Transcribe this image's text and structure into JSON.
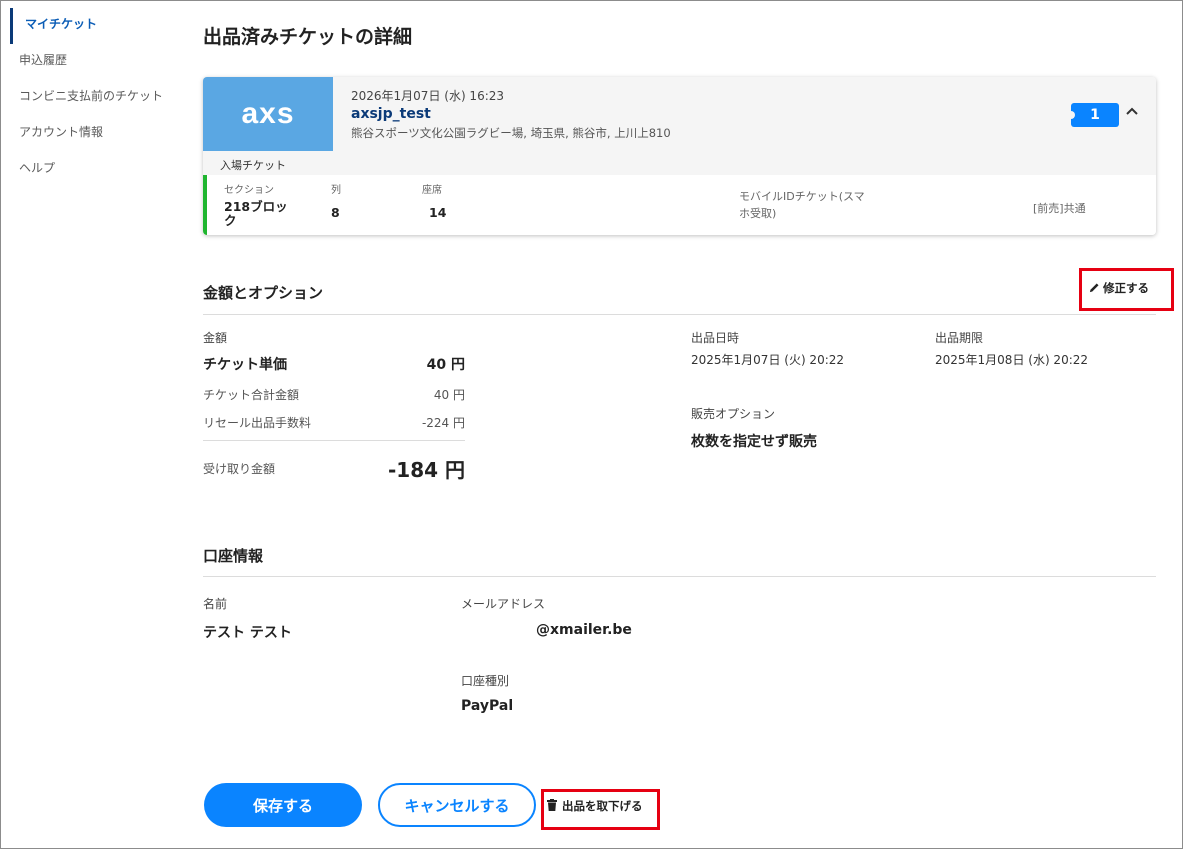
{
  "sidebar": {
    "items": [
      {
        "label": "マイチケット"
      },
      {
        "label": "申込履歴"
      },
      {
        "label": "コンビニ支払前のチケット"
      },
      {
        "label": "アカウント情報"
      },
      {
        "label": "ヘルプ"
      }
    ]
  },
  "page": {
    "title": "出品済みチケットの詳細"
  },
  "ticket": {
    "logo": "axs",
    "date": "2026年1月07日 (水) 16:23",
    "name": "axsjp_test",
    "venue": "熊谷スポーツ文化公園ラグビー場, 埼玉県, 熊谷市, 上川上810",
    "count": "1",
    "type_label": "入場チケット",
    "section_label": "セクション",
    "section_value": "218ブロック",
    "row_label": "列",
    "row_value": "8",
    "seat_label": "座席",
    "seat_value": "14",
    "delivery": "モバイルIDチケット(スマホ受取)",
    "price_type": "[前売]共通"
  },
  "price_section": {
    "title": "金額とオプション",
    "edit_label": "修正する",
    "amount_label": "金額",
    "unit_price_label": "チケット単価",
    "unit_price_value": "40 円",
    "total_label": "チケット合計金額",
    "total_value": "40 円",
    "fee_label": "リセール出品手数料",
    "fee_value": "-224 円",
    "receive_label": "受け取り金額",
    "receive_value": "-184 円",
    "listed_date_label": "出品日時",
    "listed_date_value": "2025年1月07日 (火) 20:22",
    "deadline_label": "出品期限",
    "deadline_value": "2025年1月08日 (水) 20:22",
    "option_label": "販売オプション",
    "option_value": "枚数を指定せず販売"
  },
  "account_section": {
    "title": "口座情報",
    "name_label": "名前",
    "name_value": "テスト テスト",
    "email_label": "メールアドレス",
    "email_value": "@xmailer.be",
    "type_label": "口座種別",
    "type_value": "PayPal"
  },
  "actions": {
    "save": "保存する",
    "cancel": "キャンセルする",
    "remove": "出品を取下げる"
  },
  "colors": {
    "accent": "#0a84ff",
    "highlight": "#e60012",
    "logo_bg": "#5aa7e3",
    "seat_bar": "#1fb52f"
  }
}
